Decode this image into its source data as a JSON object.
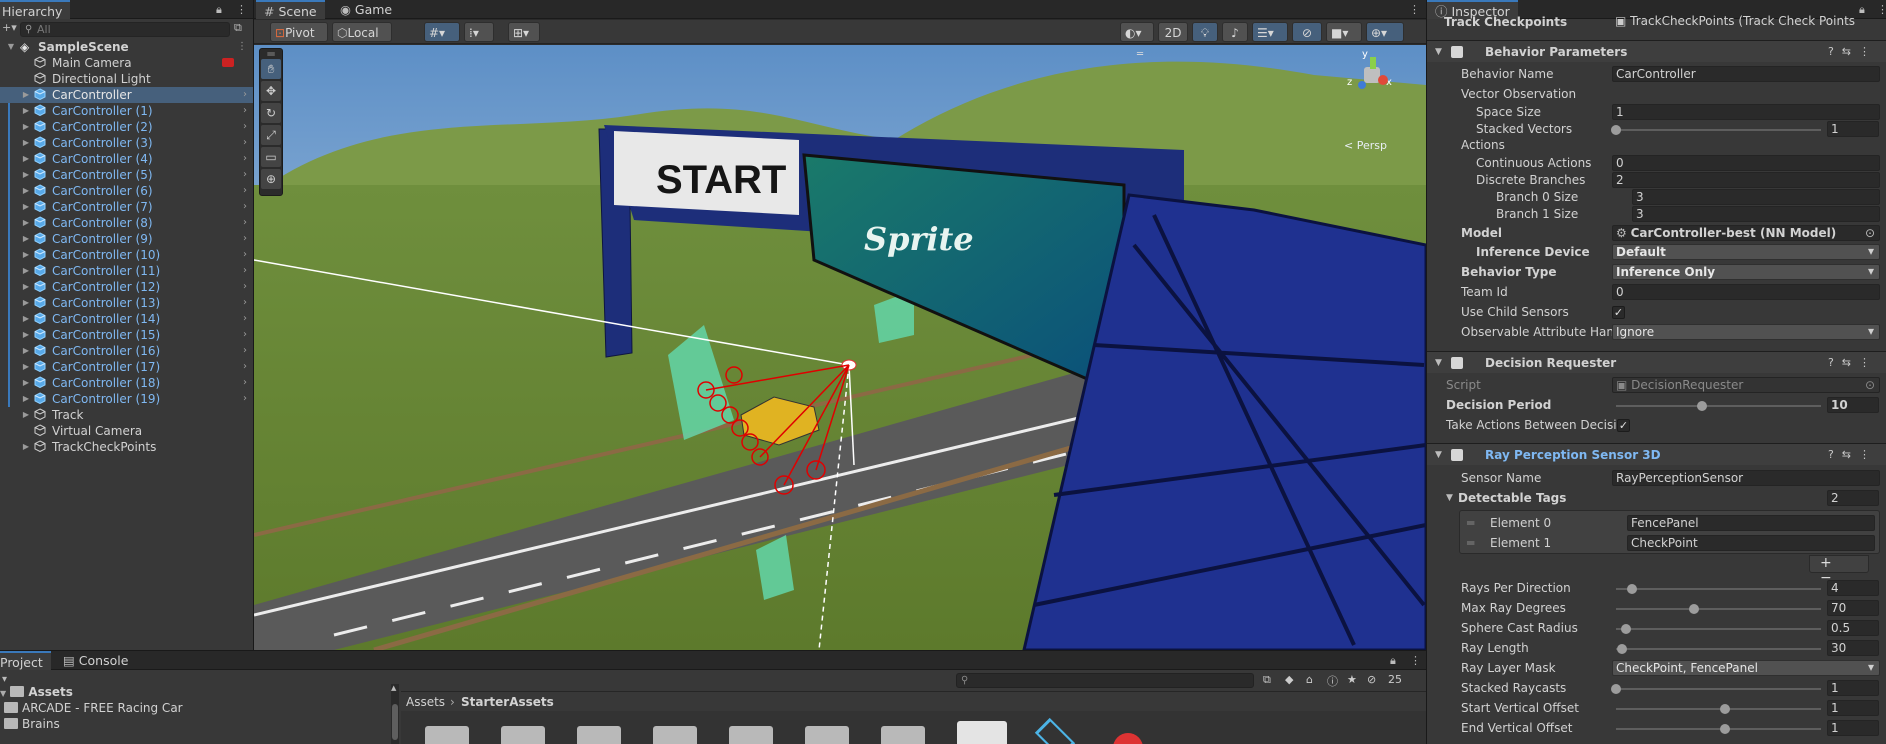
{
  "hierarchy": {
    "tab": "Hierarchy",
    "search_placeholder": "All",
    "scene": "SampleScene",
    "items": [
      {
        "label": "Main Camera"
      },
      {
        "label": "Directional Light"
      },
      {
        "label": "CarController"
      },
      {
        "label": "CarController (1)"
      },
      {
        "label": "CarController (2)"
      },
      {
        "label": "CarController (3)"
      },
      {
        "label": "CarController (4)"
      },
      {
        "label": "CarController (5)"
      },
      {
        "label": "CarController (6)"
      },
      {
        "label": "CarController (7)"
      },
      {
        "label": "CarController (8)"
      },
      {
        "label": "CarController (9)"
      },
      {
        "label": "CarController (10)"
      },
      {
        "label": "CarController (11)"
      },
      {
        "label": "CarController (12)"
      },
      {
        "label": "CarController (13)"
      },
      {
        "label": "CarController (14)"
      },
      {
        "label": "CarController (15)"
      },
      {
        "label": "CarController (16)"
      },
      {
        "label": "CarController (17)"
      },
      {
        "label": "CarController (18)"
      },
      {
        "label": "CarController (19)"
      },
      {
        "label": "Track"
      },
      {
        "label": "Virtual Camera"
      },
      {
        "label": "TrackCheckPoints"
      }
    ]
  },
  "scene": {
    "tabs": [
      "Scene",
      "Game"
    ],
    "toolbar": {
      "pivot": "Pivot",
      "local": "Local",
      "mode_2d": "2D"
    },
    "persp_label": "< Persp",
    "gizmo_axes": {
      "y": "y",
      "x": "x",
      "z": "z"
    },
    "banner_start": "START",
    "banner_brand": "Sprite"
  },
  "inspector": {
    "tab": "Inspector",
    "track_checkpoints_label": "Track Checkpoints",
    "track_checkpoints_value": "TrackCheckPoints (Track Check Points",
    "behavior": {
      "title": "Behavior Parameters",
      "behavior_name_label": "Behavior Name",
      "behavior_name": "CarController",
      "vector_observation": "Vector Observation",
      "space_size_label": "Space Size",
      "space_size": "1",
      "stacked_vectors_label": "Stacked Vectors",
      "stacked_vectors": "1",
      "actions": "Actions",
      "continuous_actions_label": "Continuous Actions",
      "continuous_actions": "0",
      "discrete_branches_label": "Discrete Branches",
      "discrete_branches": "2",
      "branch0_label": "Branch 0 Size",
      "branch0": "3",
      "branch1_label": "Branch 1 Size",
      "branch1": "3",
      "model_label": "Model",
      "model": "CarController-best (NN Model)",
      "inference_device_label": "Inference Device",
      "inference_device": "Default",
      "behavior_type_label": "Behavior Type",
      "behavior_type": "Inference Only",
      "team_id_label": "Team Id",
      "team_id": "0",
      "use_child_sensors_label": "Use Child Sensors",
      "use_child_sensors": true,
      "observable_label": "Observable Attribute Hand",
      "observable": "Ignore"
    },
    "decision": {
      "title": "Decision Requester",
      "script_label": "Script",
      "script": "DecisionRequester",
      "period_label": "Decision Period",
      "period": "10",
      "period_fraction": 0.42,
      "take_actions_label": "Take Actions Between Decisic",
      "take_actions": true
    },
    "ray": {
      "title": "Ray Perception Sensor 3D",
      "sensor_name_label": "Sensor Name",
      "sensor_name": "RayPerceptionSensor",
      "detectable_tags_label": "Detectable Tags",
      "detectable_tags_count": "2",
      "element0_label": "Element 0",
      "element0": "FencePanel",
      "element1_label": "Element 1",
      "element1": "CheckPoint",
      "rays_per_direction_label": "Rays Per Direction",
      "rays_per_direction": "4",
      "rays_per_direction_fraction": 0.08,
      "max_ray_degrees_label": "Max Ray Degrees",
      "max_ray_degrees": "70",
      "max_ray_degrees_fraction": 0.38,
      "sphere_cast_radius_label": "Sphere Cast Radius",
      "sphere_cast_radius": "0.5",
      "sphere_cast_radius_fraction": 0.05,
      "ray_length_label": "Ray Length",
      "ray_length": "30",
      "ray_length_fraction": 0.03,
      "ray_layer_mask_label": "Ray Layer Mask",
      "ray_layer_mask": "CheckPoint, FencePanel",
      "stacked_raycasts_label": "Stacked Raycasts",
      "stacked_raycasts": "1",
      "stacked_raycasts_fraction": 0.0,
      "start_vertical_offset_label": "Start Vertical Offset",
      "start_vertical_offset": "1",
      "start_vertical_offset_fraction": 0.53,
      "end_vertical_offset_label": "End Vertical Offset",
      "end_vertical_offset": "1",
      "end_vertical_offset_fraction": 0.53
    }
  },
  "project": {
    "tabs": [
      "Project",
      "Console"
    ],
    "tree": [
      "Assets",
      "ARCADE - FREE Racing Car",
      "Brains"
    ],
    "breadcrumb": [
      "Assets",
      "StarterAssets"
    ],
    "hidden_count": "25"
  }
}
